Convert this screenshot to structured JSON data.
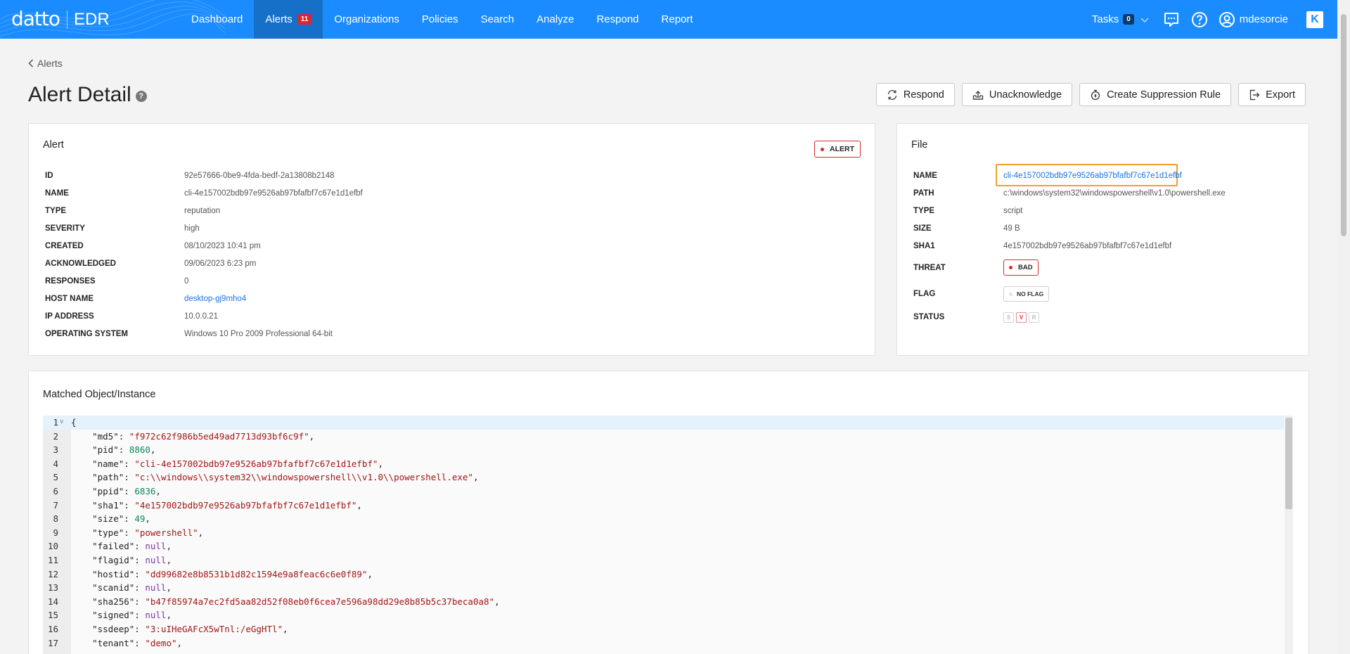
{
  "app": {
    "brand": "datto",
    "product": "EDR"
  },
  "nav": {
    "items": [
      {
        "label": "Dashboard"
      },
      {
        "label": "Alerts",
        "badge": "11",
        "active": true
      },
      {
        "label": "Organizations"
      },
      {
        "label": "Policies"
      },
      {
        "label": "Search"
      },
      {
        "label": "Analyze"
      },
      {
        "label": "Respond"
      },
      {
        "label": "Report"
      }
    ],
    "tasks_label": "Tasks",
    "tasks_count": "0",
    "user": "mdesorcie",
    "k_logo": "K"
  },
  "breadcrumb": "Alerts",
  "page": {
    "title": "Alert Detail",
    "help_glyph": "?"
  },
  "actions": {
    "respond": "Respond",
    "unacknowledge": "Unacknowledge",
    "suppression": "Create Suppression Rule",
    "export": "Export"
  },
  "alert_card": {
    "title": "Alert",
    "badge": "ALERT",
    "rows": [
      {
        "key": "ID",
        "value": "92e57666-0be9-4fda-bedf-2a13808b2148"
      },
      {
        "key": "NAME",
        "value": "cli-4e157002bdb97e9526ab97bfafbf7c67e1d1efbf"
      },
      {
        "key": "TYPE",
        "value": "reputation"
      },
      {
        "key": "SEVERITY",
        "value": "high"
      },
      {
        "key": "CREATED",
        "value": "08/10/2023 10:41 pm"
      },
      {
        "key": "ACKNOWLEDGED",
        "value": "09/06/2023 6:23 pm"
      },
      {
        "key": "RESPONSES",
        "value": "0"
      },
      {
        "key": "HOST NAME",
        "value": "desktop-gj9mho4"
      },
      {
        "key": "IP ADDRESS",
        "value": "10.0.0.21"
      },
      {
        "key": "OPERATING SYSTEM",
        "value": "Windows 10 Pro 2009 Professional 64-bit"
      }
    ]
  },
  "file_card": {
    "title": "File",
    "name_key": "NAME",
    "name": "cli-4e157002bdb97e9526ab97bfafbf7c67e1d1efbf",
    "path_key": "PATH",
    "path": "c:\\windows\\system32\\windowspowershell\\v1.0\\powershell.exe",
    "type_key": "TYPE",
    "type": "script",
    "size_key": "SIZE",
    "size": "49 B",
    "sha1_key": "SHA1",
    "sha1": "4e157002bdb97e9526ab97bfafbf7c67e1d1efbf",
    "threat_key": "THREAT",
    "threat": "BAD",
    "flag_key": "FLAG",
    "flag": "NO FLAG",
    "status_key": "STATUS",
    "status": [
      "S",
      "V",
      "R"
    ]
  },
  "matched": {
    "title": "Matched Object/Instance",
    "lines": [
      {
        "n": "1",
        "fold": "v",
        "code": "{"
      },
      {
        "n": "2",
        "key": "md5",
        "val": "\"f972c62f986b5ed49ad7713d93bf6c9f\"",
        "kind": "s"
      },
      {
        "n": "3",
        "key": "pid",
        "val": "8860",
        "kind": "n"
      },
      {
        "n": "4",
        "key": "name",
        "val": "\"cli-4e157002bdb97e9526ab97bfafbf7c67e1d1efbf\"",
        "kind": "s"
      },
      {
        "n": "5",
        "key": "path",
        "val": "\"c:\\\\windows\\\\system32\\\\windowspowershell\\\\v1.0\\\\powershell.exe\"",
        "kind": "s"
      },
      {
        "n": "6",
        "key": "ppid",
        "val": "6836",
        "kind": "n"
      },
      {
        "n": "7",
        "key": "sha1",
        "val": "\"4e157002bdb97e9526ab97bfafbf7c67e1d1efbf\"",
        "kind": "s"
      },
      {
        "n": "8",
        "key": "size",
        "val": "49",
        "kind": "n"
      },
      {
        "n": "9",
        "key": "type",
        "val": "\"powershell\"",
        "kind": "s"
      },
      {
        "n": "10",
        "key": "failed",
        "val": "null",
        "kind": "nl"
      },
      {
        "n": "11",
        "key": "flagid",
        "val": "null",
        "kind": "nl"
      },
      {
        "n": "12",
        "key": "hostid",
        "val": "\"dd99682e8b8531b1d82c1594e9a8feac6c6e0f89\"",
        "kind": "s"
      },
      {
        "n": "13",
        "key": "scanid",
        "val": "null",
        "kind": "nl"
      },
      {
        "n": "14",
        "key": "sha256",
        "val": "\"b47f85974a7ec2fd5aa82d52f08eb0f6cea7e596a98dd29e8b85b5c37beca0a8\"",
        "kind": "s"
      },
      {
        "n": "15",
        "key": "signed",
        "val": "null",
        "kind": "nl"
      },
      {
        "n": "16",
        "key": "ssdeep",
        "val": "\"3:uIHeGAFcX5wTnl:/eGgHTl\"",
        "kind": "s"
      },
      {
        "n": "17",
        "key": "tenant",
        "val": "\"demo\"",
        "kind": "s"
      }
    ]
  },
  "colors": {
    "nav_bg": "#1a8cff",
    "nav_active": "#1670c8",
    "alert_red": "#d9262f",
    "link_blue": "#1a73e8",
    "highlight": "#f0a030"
  }
}
